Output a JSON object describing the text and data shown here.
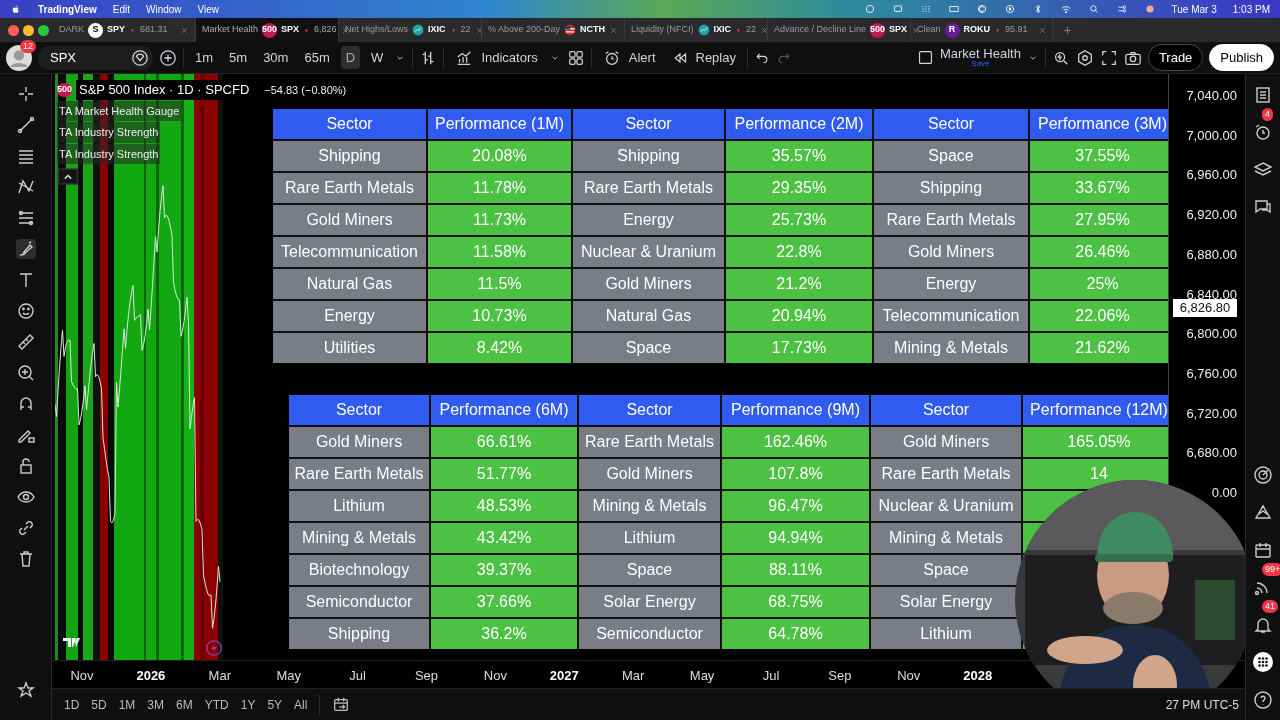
{
  "menu_bar": {
    "app": "TradingView",
    "items": [
      "Edit",
      "Window",
      "View"
    ],
    "date": "Tue Mar 3",
    "time": "1:03 PM"
  },
  "tabs": [
    {
      "title": "DARK",
      "logo": {
        "kind": "letter",
        "text": "S",
        "color": "#ffffff"
      },
      "symbol": "SPY",
      "price": "681.31",
      "selected": false
    },
    {
      "title": "Market Health",
      "logo": {
        "kind": "letter",
        "text": "500",
        "color": "#c2185b"
      },
      "symbol": "SPX",
      "price": "6,826",
      "selected": true
    },
    {
      "title": "Net Highs/Lows",
      "logo": {
        "kind": "chart",
        "color": "#1fa5a8"
      },
      "symbol": "IXIC",
      "price": "22",
      "selected": false
    },
    {
      "title": "% Above 200-Day",
      "logo": {
        "kind": "flag",
        "color": "#c62828"
      },
      "symbol": "NCTH",
      "selected": false
    },
    {
      "title": "Liquidity (NFCI)",
      "logo": {
        "kind": "chart",
        "color": "#1fa5a8"
      },
      "symbol": "IXIC",
      "price": "22",
      "selected": false
    },
    {
      "title": "Advance / Decline Line",
      "logo": {
        "kind": "letter",
        "text": "500",
        "color": "#c2185b"
      },
      "symbol": "SPX",
      "selected": false
    },
    {
      "title": "Clean",
      "logo": {
        "kind": "letter",
        "text": "R",
        "color": "#6a1b9a"
      },
      "symbol": "ROKU",
      "price": "95.91",
      "selected": false
    }
  ],
  "toolbar": {
    "avatar_badge": "12",
    "symbol": "SPX",
    "intervals": [
      {
        "label": "1m",
        "selected": false
      },
      {
        "label": "5m",
        "selected": false
      },
      {
        "label": "30m",
        "selected": false
      },
      {
        "label": "65m",
        "selected": false
      },
      {
        "label": "D",
        "selected": true
      },
      {
        "label": "W",
        "selected": false
      }
    ],
    "indicators": "Indicators",
    "alert": "Alert",
    "replay": "Replay",
    "layout_name": "Market Health",
    "layout_save": "Save",
    "trade": "Trade",
    "publish": "Publish"
  },
  "legend": {
    "badge": "500",
    "title": "S&P 500 Index · 1D · SPCFD",
    "change": "−54.83 (−0.80%)",
    "indicators": [
      "TA Market Health Gauge",
      "TA Industry Strength",
      "TA Industry Strength"
    ]
  },
  "tables": [
    {
      "groups": [
        {
          "sector_header": "Sector",
          "performance_header": "Performance (1M)",
          "rows": [
            {
              "sector": "Shipping",
              "value": "20.08%"
            },
            {
              "sector": "Rare Earth Metals",
              "value": "11.78%"
            },
            {
              "sector": "Gold Miners",
              "value": "11.73%"
            },
            {
              "sector": "Telecommunication",
              "value": "11.58%"
            },
            {
              "sector": "Natural Gas",
              "value": "11.5%"
            },
            {
              "sector": "Energy",
              "value": "10.73%"
            },
            {
              "sector": "Utilities",
              "value": "8.42%"
            }
          ]
        },
        {
          "sector_header": "Sector",
          "performance_header": "Performance (2M)",
          "rows": [
            {
              "sector": "Shipping",
              "value": "35.57%"
            },
            {
              "sector": "Rare Earth Metals",
              "value": "29.35%"
            },
            {
              "sector": "Energy",
              "value": "25.73%"
            },
            {
              "sector": "Nuclear & Uranium",
              "value": "22.8%"
            },
            {
              "sector": "Gold Miners",
              "value": "21.2%"
            },
            {
              "sector": "Natural Gas",
              "value": "20.94%"
            },
            {
              "sector": "Space",
              "value": "17.73%"
            }
          ]
        },
        {
          "sector_header": "Sector",
          "performance_header": "Performance (3M)",
          "rows": [
            {
              "sector": "Space",
              "value": "37.55%"
            },
            {
              "sector": "Shipping",
              "value": "33.67%"
            },
            {
              "sector": "Rare Earth Metals",
              "value": "27.95%"
            },
            {
              "sector": "Gold Miners",
              "value": "26.46%"
            },
            {
              "sector": "Energy",
              "value": "25%"
            },
            {
              "sector": "Telecommunication",
              "value": "22.06%"
            },
            {
              "sector": "Mining & Metals",
              "value": "21.62%"
            }
          ]
        }
      ]
    },
    {
      "groups": [
        {
          "sector_header": "Sector",
          "performance_header": "Performance (6M)",
          "rows": [
            {
              "sector": "Gold Miners",
              "value": "66.61%"
            },
            {
              "sector": "Rare Earth Metals",
              "value": "51.77%"
            },
            {
              "sector": "Lithium",
              "value": "48.53%"
            },
            {
              "sector": "Mining & Metals",
              "value": "43.42%"
            },
            {
              "sector": "Biotechnology",
              "value": "39.37%"
            },
            {
              "sector": "Semiconductor",
              "value": "37.66%"
            },
            {
              "sector": "Shipping",
              "value": "36.2%"
            }
          ]
        },
        {
          "sector_header": "Sector",
          "performance_header": "Performance (9M)",
          "rows": [
            {
              "sector": "Rare Earth Metals",
              "value": "162.46%"
            },
            {
              "sector": "Gold Miners",
              "value": "107.8%"
            },
            {
              "sector": "Mining & Metals",
              "value": "96.47%"
            },
            {
              "sector": "Lithium",
              "value": "94.94%"
            },
            {
              "sector": "Space",
              "value": "88.11%"
            },
            {
              "sector": "Solar Energy",
              "value": "68.75%"
            },
            {
              "sector": "Semiconductor",
              "value": "64.78%"
            }
          ]
        },
        {
          "sector_header": "Sector",
          "performance_header": "Performance (12M)",
          "rows": [
            {
              "sector": "Gold Miners",
              "value": "165.05%"
            },
            {
              "sector": "Rare Earth Metals",
              "value": "14"
            },
            {
              "sector": "Nuclear & Uranium"
            },
            {
              "sector": "Mining & Metals"
            },
            {
              "sector": "Space"
            },
            {
              "sector": "Solar Energy"
            },
            {
              "sector": "Lithium"
            }
          ]
        }
      ]
    }
  ],
  "price_axis": {
    "labels": [
      "7,040.00",
      "7,000.00",
      "6,960.00",
      "6,920.00",
      "6,880.00",
      "6,840.00",
      "6,800.00",
      "6,760.00",
      "6,720.00",
      "6,680.00",
      "0.00"
    ],
    "current": "6,826.80"
  },
  "time_axis": [
    {
      "label": "Nov",
      "year": false
    },
    {
      "label": "2026",
      "year": true
    },
    {
      "label": "Mar",
      "year": false
    },
    {
      "label": "May",
      "year": false
    },
    {
      "label": "Jul",
      "year": false
    },
    {
      "label": "Sep",
      "year": false
    },
    {
      "label": "Nov",
      "year": false
    },
    {
      "label": "2027",
      "year": true
    },
    {
      "label": "Mar",
      "year": false
    },
    {
      "label": "May",
      "year": false
    },
    {
      "label": "Jul",
      "year": false
    },
    {
      "label": "Sep",
      "year": false
    },
    {
      "label": "Nov",
      "year": false
    },
    {
      "label": "2028",
      "year": true
    }
  ],
  "ranges": [
    "1D",
    "5D",
    "1M",
    "3M",
    "6M",
    "YTD",
    "1Y",
    "5Y",
    "All"
  ],
  "timestamp": "27 PM UTC-5",
  "right_bar": {
    "alerts_badge": "4",
    "ideas_badge": "99+",
    "notifications_badge": "41"
  }
}
